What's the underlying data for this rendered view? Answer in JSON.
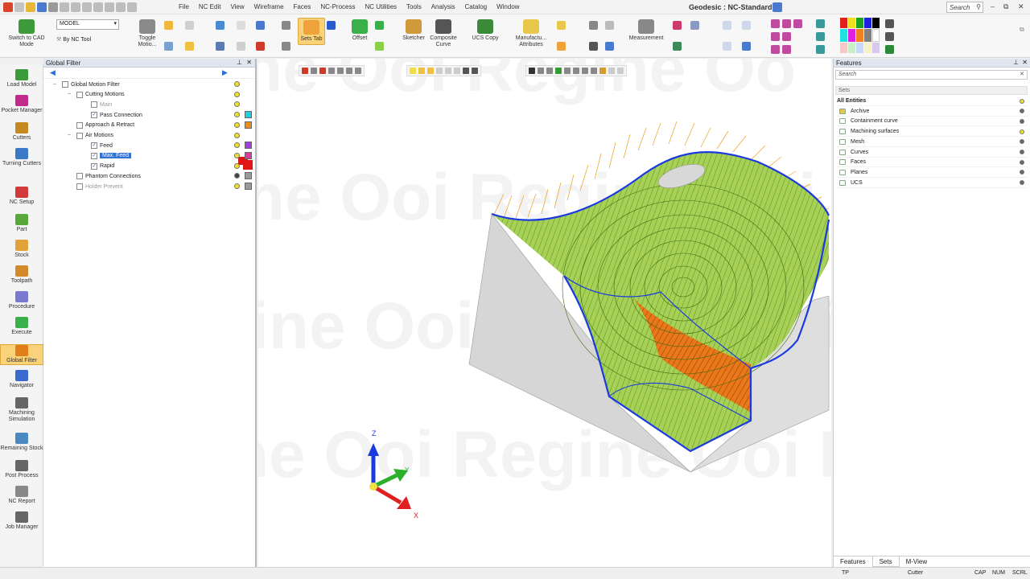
{
  "title_bar": {
    "menus": [
      "File",
      "NC Edit",
      "View",
      "Wireframe",
      "Faces",
      "NC-Process",
      "NC Utilities",
      "Tools",
      "Analysis",
      "Catalog",
      "Window"
    ],
    "document_title": "Geodesic : NC-Standard",
    "search_placeholder": "Search",
    "search_icon": "search-icon",
    "window_buttons": {
      "minimize": "–",
      "restore": "⧉",
      "close": "✕"
    }
  },
  "ribbon": {
    "switch_cad": "Switch to CAD Mode",
    "model_combo": "MODEL",
    "nc_tool": "By NC Tool",
    "toggle_motion": "Toggle Motio...",
    "sets_tab": "Sets Tab",
    "offset": "Offset",
    "sketcher": "Sketcher",
    "composite_curve": "Composite Curve",
    "ucs_copy": "UCS Copy",
    "manufacturing_attributes": "Manufactu... Attributes",
    "measurement": "Measurement"
  },
  "left_toolbar": {
    "items": [
      {
        "label": "Load Model",
        "color": "#3d9a3a"
      },
      {
        "label": "Pocket Manager",
        "color": "#c02a8a"
      },
      {
        "label": "Cutters",
        "color": "#c58a1f"
      },
      {
        "label": "Turning Cutters",
        "color": "#3b78c8"
      },
      {
        "label": "NC Setup",
        "color": "#d23a3a"
      },
      {
        "label": "Part",
        "color": "#5aa83a"
      },
      {
        "label": "Stock",
        "color": "#e0a23a"
      },
      {
        "label": "Toolpath",
        "color": "#d28a2a"
      },
      {
        "label": "Procedure",
        "color": "#7a7ad0"
      },
      {
        "label": "Execute",
        "color": "#3ab04a"
      },
      {
        "label": "Global Filter",
        "color": "#e07f1a"
      },
      {
        "label": "Navigator",
        "color": "#3a6ad0"
      },
      {
        "label": "Machining Simulation",
        "color": "#666666"
      },
      {
        "label": "Remaining Stock",
        "color": "#4a8ac0"
      },
      {
        "label": "Post Process",
        "color": "#666666"
      },
      {
        "label": "NC Report",
        "color": "#888888"
      },
      {
        "label": "Job Manager",
        "color": "#666666"
      }
    ],
    "active_index": 10
  },
  "global_filter": {
    "header": "Global Filter",
    "pin": "⊥",
    "close": "✕",
    "nav_back": "◀",
    "nav_forward": "▶",
    "nodes": [
      {
        "label": "Global Motion Filter",
        "level": 0,
        "bulb": "#f2e12a",
        "swatch": null
      },
      {
        "label": "Cutting Motions",
        "level": 1,
        "bulb": "#f2e12a",
        "swatch": null
      },
      {
        "label": "Main",
        "level": 2,
        "bulb": "#f2e12a",
        "swatch": null,
        "dim": true
      },
      {
        "label": "Pass Connection",
        "level": 2,
        "bulb": "#f2e12a",
        "swatch": "#1fd0e0"
      },
      {
        "label": "Approach & Retract",
        "level": 1,
        "bulb": "#f2e12a",
        "swatch": "#f08a1a"
      },
      {
        "label": "Air Motions",
        "level": 1,
        "bulb": "#f2e12a",
        "swatch": null
      },
      {
        "label": "Feed",
        "level": 2,
        "bulb": "#f2e12a",
        "swatch": "#a040e0"
      },
      {
        "label": "Max. Feed",
        "level": 2,
        "bulb": "#f2e12a",
        "swatch": "#e03aa0",
        "selected": true
      },
      {
        "label": "Rapid",
        "level": 2,
        "bulb": "#f2e12a",
        "swatch": null
      },
      {
        "label": "Phantom Connections",
        "level": 1,
        "bulb": "#444444",
        "swatch": "#9a9a9a"
      },
      {
        "label": "Holder Prevent",
        "level": 1,
        "bulb": "#f2e12a",
        "swatch": "#9a9a9a",
        "dim": true
      }
    ]
  },
  "viewport": {
    "axes": {
      "x": "X",
      "y": "Y",
      "z": "Z"
    },
    "watermark": "Regine Ooi"
  },
  "features": {
    "header": "Features",
    "pin": "⊥",
    "close": "✕",
    "search_placeholder": "Search",
    "sets_label": "Sets",
    "rows": [
      {
        "label": "All Entities",
        "bold": true
      },
      {
        "label": "Archive"
      },
      {
        "label": "Containment curve"
      },
      {
        "label": "Machining surfaces"
      },
      {
        "label": "Mesh"
      },
      {
        "label": "Curves"
      },
      {
        "label": "Faces"
      },
      {
        "label": "Planes"
      },
      {
        "label": "UCS"
      }
    ],
    "tabs": [
      "Features",
      "Sets",
      "M-View"
    ],
    "active_tab": 1
  },
  "status_bar": {
    "left": "TP",
    "middle": "Cutter",
    "caps": "CAP",
    "num": "NUM",
    "scrl": "SCRL"
  },
  "colors": {
    "toolpath_green": "#8cc63f",
    "boundary_blue": "#1a3adf",
    "orange_region": "#e06a10",
    "air_motion_orange": "#f0a020",
    "block_gray": "#d4d4d4"
  }
}
